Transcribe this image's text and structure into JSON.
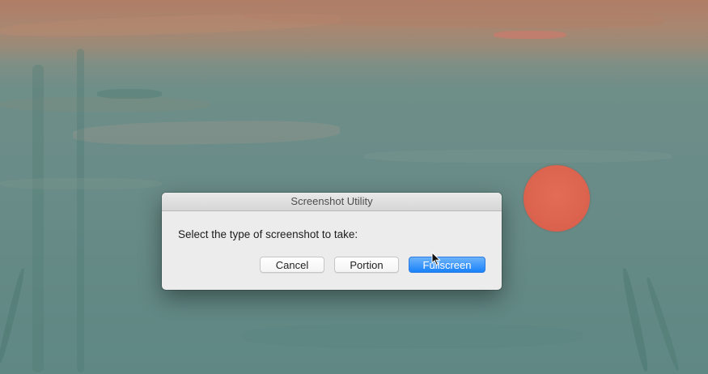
{
  "dialog": {
    "title": "Screenshot Utility",
    "message": "Select the type of screenshot to take:",
    "buttons": {
      "cancel_label": "Cancel",
      "portion_label": "Portion",
      "fullscreen_label": "Fullscreen"
    }
  },
  "colors": {
    "default_button": "#1a82fb",
    "sun": "#dc6550"
  },
  "icons": {
    "cursor": "arrow-cursor-icon"
  }
}
